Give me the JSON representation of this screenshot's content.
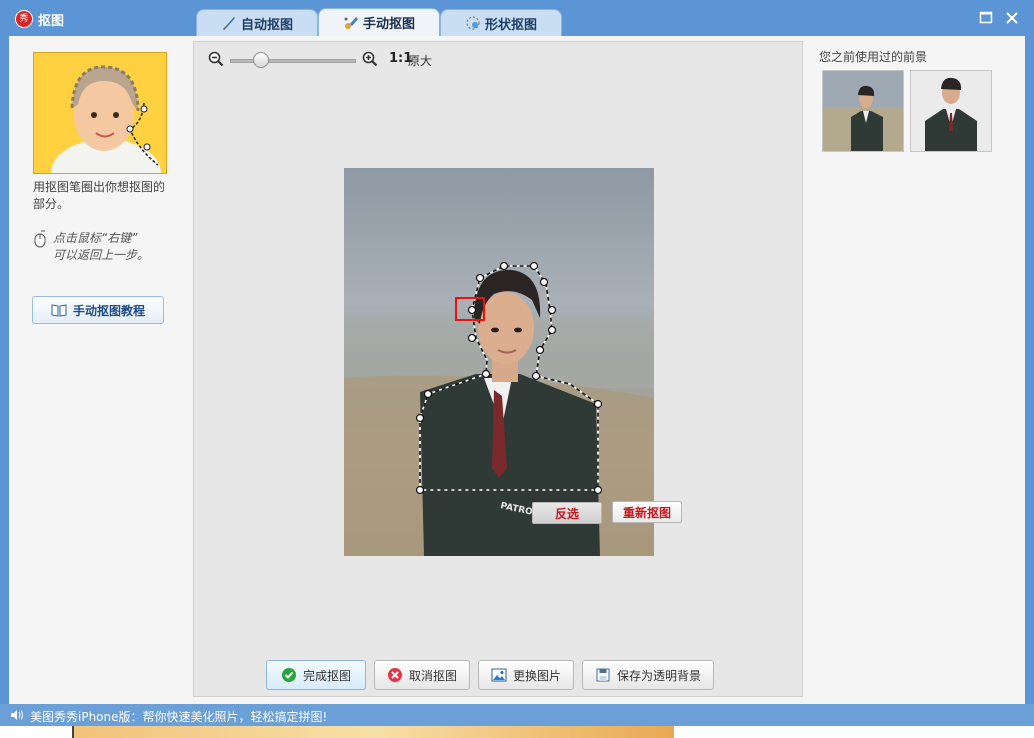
{
  "window": {
    "title": "抠图",
    "logo_text": "秀"
  },
  "tabs": [
    {
      "label": "自动抠图",
      "icon": "brush-icon"
    },
    {
      "label": "手动抠图",
      "icon": "hand-brush-icon",
      "active": true
    },
    {
      "label": "形状抠图",
      "icon": "shape-icon"
    }
  ],
  "left": {
    "help_text": "用抠图笔圈出你想抠图的部分。",
    "tip_line1": "点击鼠标“右键”",
    "tip_line2": "可以返回上一步。",
    "tutorial_label": "手动抠图教程"
  },
  "zoom": {
    "ratio_label": "1:1",
    "original_label": "原大",
    "slider_level": 0.24
  },
  "canvas": {
    "invert_label": "反选",
    "redo_label": "重新抠图"
  },
  "actions": {
    "done_label": "完成抠图",
    "cancel_label": "取消抠图",
    "replace_label": "更换图片",
    "save_transparent_label": "保存为透明背景"
  },
  "right": {
    "recent_title": "您之前使用过的前景"
  },
  "status": {
    "text": "美图秀秀iPhone版：帮你快速美化照片，轻松搞定拼图!"
  },
  "colors": {
    "titlebar": "#5b95d5",
    "accent_red": "#c8161d",
    "client_bg": "#f5f5f5"
  }
}
